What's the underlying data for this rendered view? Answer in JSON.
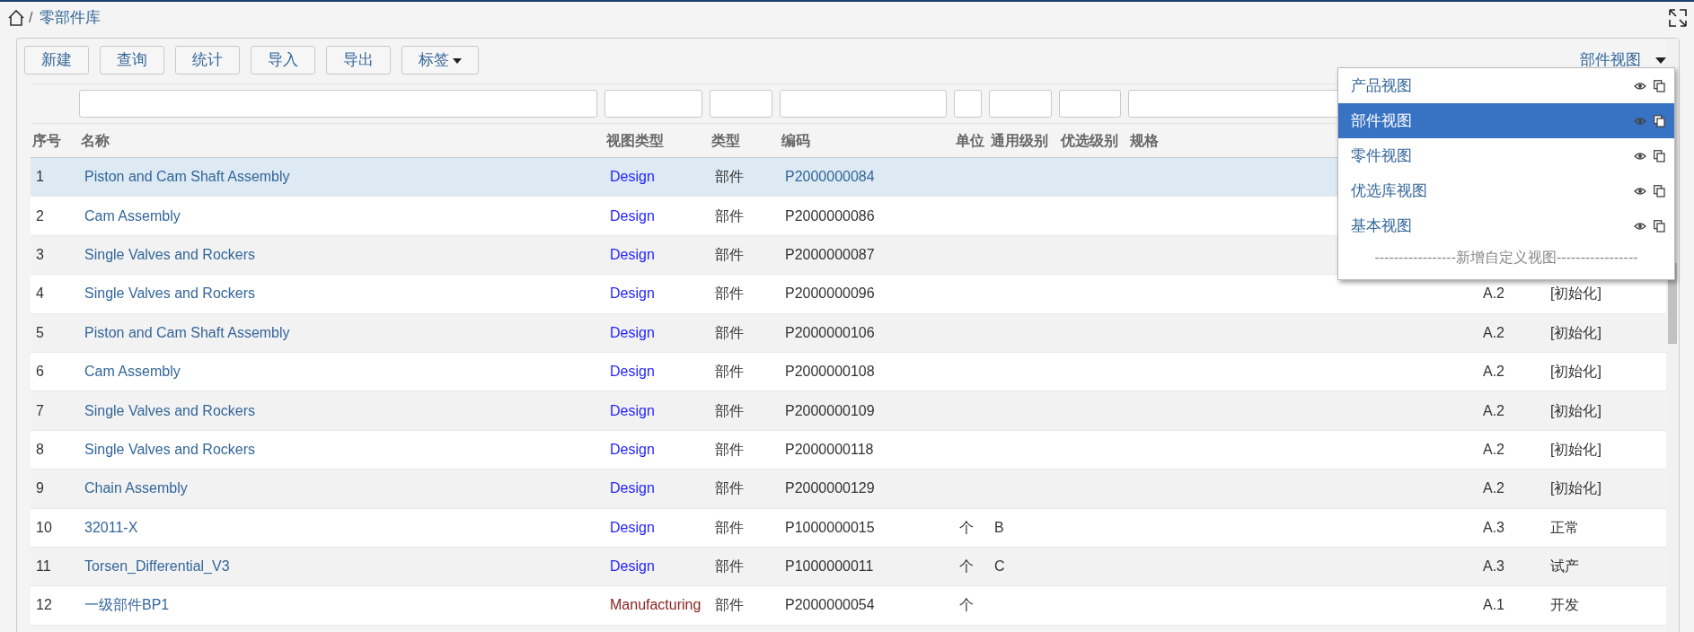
{
  "breadcrumb": {
    "separator": "/",
    "items": [
      "零部件库"
    ]
  },
  "toolbar": {
    "buttons": [
      {
        "label": "新建",
        "dropdown": false
      },
      {
        "label": "查询",
        "dropdown": false
      },
      {
        "label": "统计",
        "dropdown": false
      },
      {
        "label": "导入",
        "dropdown": false
      },
      {
        "label": "导出",
        "dropdown": false
      },
      {
        "label": "标签",
        "dropdown": true
      }
    ]
  },
  "view_menu": {
    "label": "部件视图",
    "expanded": true,
    "items": [
      {
        "label": "产品视图",
        "selected": false
      },
      {
        "label": "部件视图",
        "selected": true
      },
      {
        "label": "零件视图",
        "selected": false
      },
      {
        "label": "优选库视图",
        "selected": false
      },
      {
        "label": "基本视图",
        "selected": false
      }
    ],
    "footer": "-----------------新增自定义视图-----------------"
  },
  "table": {
    "columns": [
      "序号",
      "名称",
      "视图类型",
      "类型",
      "编码",
      "单位",
      "通用级别",
      "优选级别",
      "规格"
    ],
    "rows": [
      {
        "selected": true,
        "index": "1",
        "name": "Piston and Cam Shaft Assembly",
        "view_type": {
          "text": "Design",
          "color": "#1f1fff"
        },
        "type": "部件",
        "code": "P2000000084"
      },
      {
        "selected": false,
        "index": "2",
        "name": "Cam Assembly",
        "view_type": {
          "text": "Design",
          "color": "#1f1fff"
        },
        "type": "部件",
        "code": "P2000000086"
      },
      {
        "selected": false,
        "index": "3",
        "name": "Single Valves and Rockers",
        "view_type": {
          "text": "Design",
          "color": "#1f1fff"
        },
        "type": "部件",
        "code": "P2000000087"
      },
      {
        "selected": false,
        "index": "4",
        "name": "Single Valves and Rockers",
        "view_type": {
          "text": "Design",
          "color": "#1f1fff"
        },
        "type": "部件",
        "code": "P2000000096",
        "version": "A.2",
        "status": "[初始化]"
      },
      {
        "selected": false,
        "index": "5",
        "name": "Piston and Cam Shaft Assembly",
        "view_type": {
          "text": "Design",
          "color": "#1f1fff"
        },
        "type": "部件",
        "code": "P2000000106",
        "version": "A.2",
        "status": "[初始化]"
      },
      {
        "selected": false,
        "index": "6",
        "name": "Cam Assembly",
        "view_type": {
          "text": "Design",
          "color": "#1f1fff"
        },
        "type": "部件",
        "code": "P2000000108",
        "version": "A.2",
        "status": "[初始化]"
      },
      {
        "selected": false,
        "index": "7",
        "name": "Single Valves and Rockers",
        "view_type": {
          "text": "Design",
          "color": "#1f1fff"
        },
        "type": "部件",
        "code": "P2000000109",
        "version": "A.2",
        "status": "[初始化]"
      },
      {
        "selected": false,
        "index": "8",
        "name": "Single Valves and Rockers",
        "view_type": {
          "text": "Design",
          "color": "#1f1fff"
        },
        "type": "部件",
        "code": "P2000000118",
        "version": "A.2",
        "status": "[初始化]"
      },
      {
        "selected": false,
        "index": "9",
        "name": "Chain Assembly",
        "view_type": {
          "text": "Design",
          "color": "#1f1fff"
        },
        "type": "部件",
        "code": "P2000000129",
        "version": "A.2",
        "status": "[初始化]"
      },
      {
        "selected": false,
        "index": "10",
        "name": "32011-X",
        "view_type": {
          "text": "Design",
          "color": "#1f1fff"
        },
        "type": "部件",
        "code": "P1000000015",
        "unit": "个",
        "general_level": "B",
        "version": "A.3",
        "status": "正常"
      },
      {
        "selected": false,
        "index": "11",
        "name": "Torsen_Differential_V3",
        "view_type": {
          "text": "Design",
          "color": "#1f1fff"
        },
        "type": "部件",
        "code": "P1000000011",
        "unit": "个",
        "general_level": "C",
        "version": "A.3",
        "status": "试产"
      },
      {
        "selected": false,
        "index": "12",
        "name": "一级部件BP1",
        "view_type": {
          "text": "Manufacturing",
          "color": "#8b2323"
        },
        "type": "部件",
        "code": "P2000000054",
        "unit": "个",
        "version": "A.1",
        "status": "开发"
      }
    ]
  }
}
